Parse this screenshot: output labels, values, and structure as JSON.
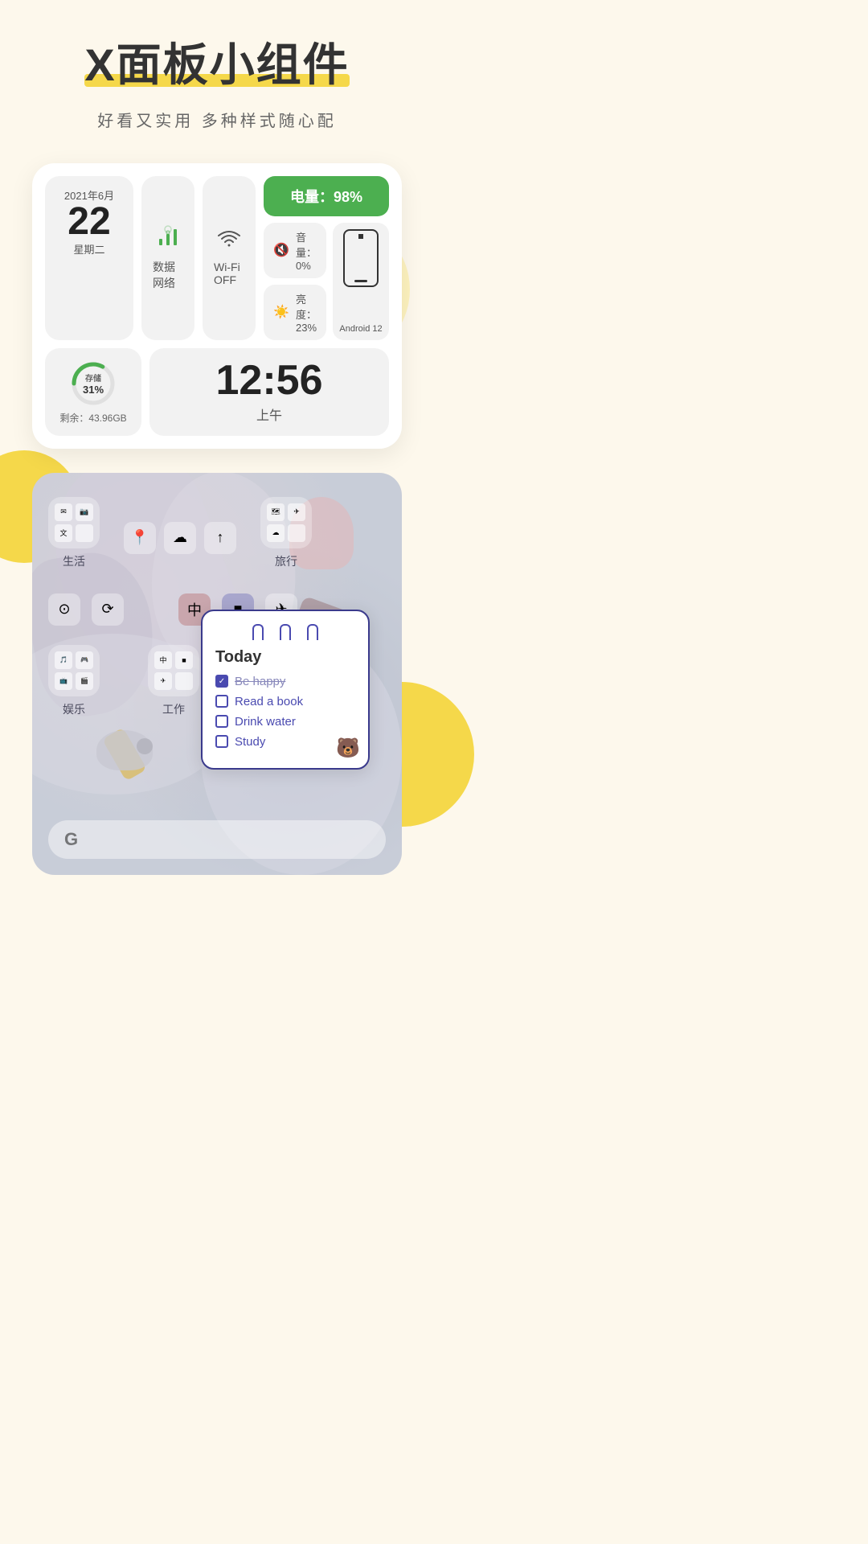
{
  "title": "X面板小组件",
  "title_highlight_color": "#f5d84a",
  "subtitle": "好看又实用  多种样式随心配",
  "widget": {
    "date": {
      "year_month": "2021年6月",
      "day": "22",
      "weekday": "星期二"
    },
    "network": {
      "label": "数据网络",
      "icon": "📶"
    },
    "wifi": {
      "label": "Wi-Fi OFF",
      "icon": "📶"
    },
    "battery": {
      "label": "电量：98%",
      "color": "#4caf50"
    },
    "volume": {
      "label": "音量：0%",
      "icon": "🔇"
    },
    "brightness": {
      "label": "亮度：23%",
      "icon": "☀️"
    },
    "android": {
      "label": "Android 12"
    },
    "storage": {
      "percent": "31%",
      "label": "存储",
      "remain": "剩余：43.96GB",
      "ring_color": "#4caf50"
    },
    "time": {
      "display": "12:56",
      "ampm": "上午"
    }
  },
  "phone_screen": {
    "folders": [
      {
        "label": "生活",
        "icons": [
          "✉",
          "📷",
          "文"
        ]
      },
      {
        "label": "旅行",
        "icons": [
          "📍",
          "☁",
          "↑"
        ]
      }
    ],
    "folders2": [
      {
        "label": "娱乐",
        "icons": [
          "⊙",
          "⟳"
        ]
      },
      {
        "label": "工作",
        "icons": [
          "中",
          "■",
          "✈"
        ]
      }
    ],
    "note": {
      "title": "Today",
      "items": [
        {
          "text": "Be happy",
          "checked": true,
          "done": true
        },
        {
          "text": "Read a book",
          "checked": false,
          "done": false
        },
        {
          "text": "Drink water",
          "checked": false,
          "done": false
        },
        {
          "text": "Study",
          "checked": false,
          "done": false
        }
      ]
    },
    "google_label": "G"
  }
}
